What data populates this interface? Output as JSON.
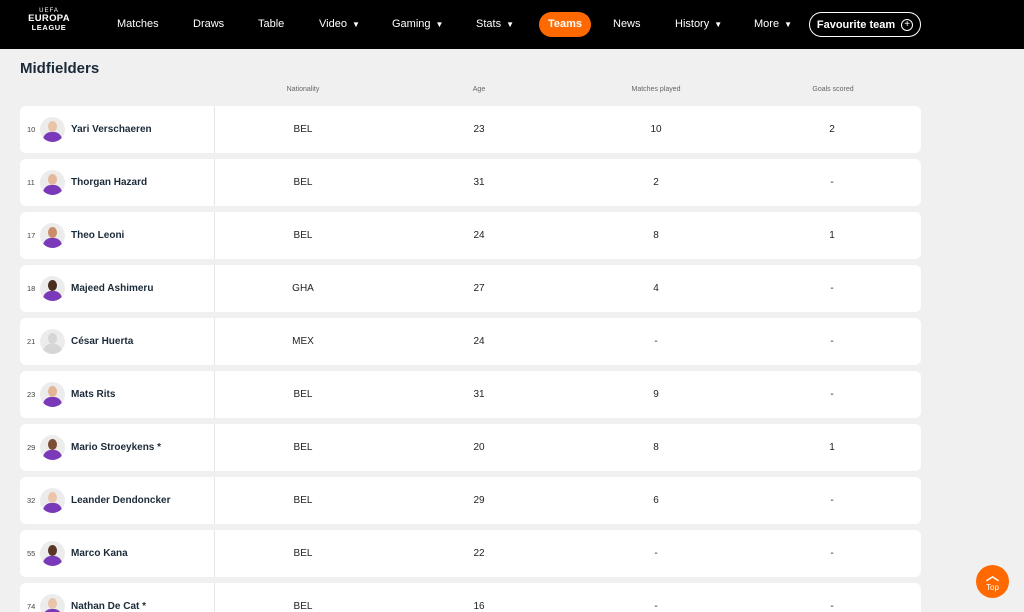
{
  "brand": {
    "line1": "UEFA",
    "line2": "EUROPA",
    "line3": "LEAGUE"
  },
  "nav": {
    "items": [
      {
        "label": "Matches",
        "dropdown": false
      },
      {
        "label": "Draws",
        "dropdown": false
      },
      {
        "label": "Table",
        "dropdown": false
      },
      {
        "label": "Video",
        "dropdown": true
      },
      {
        "label": "Gaming",
        "dropdown": true
      },
      {
        "label": "Stats",
        "dropdown": true
      },
      {
        "label": "Teams",
        "dropdown": false,
        "active": true
      },
      {
        "label": "News",
        "dropdown": false
      },
      {
        "label": "History",
        "dropdown": true
      },
      {
        "label": "More",
        "dropdown": true
      }
    ],
    "caret": "▼",
    "favourite_label": "Favourite team",
    "favourite_icon": "plus-circle-icon"
  },
  "section": {
    "title": "Midfielders"
  },
  "columns": {
    "nationality": "Nationality",
    "age": "Age",
    "matches": "Matches played",
    "goals": "Goals scored"
  },
  "players": [
    {
      "num": "10",
      "name": "Yari Verschaeren",
      "nat": "BEL",
      "age": "23",
      "matches": "10",
      "goals": "2",
      "skin": "#e8c4a8",
      "photo": true
    },
    {
      "num": "11",
      "name": "Thorgan Hazard",
      "nat": "BEL",
      "age": "31",
      "matches": "2",
      "goals": "-",
      "skin": "#e3b99a",
      "photo": true
    },
    {
      "num": "17",
      "name": "Theo Leoni",
      "nat": "BEL",
      "age": "24",
      "matches": "8",
      "goals": "1",
      "skin": "#c98d6a",
      "photo": true
    },
    {
      "num": "18",
      "name": "Majeed Ashimeru",
      "nat": "GHA",
      "age": "27",
      "matches": "4",
      "goals": "-",
      "skin": "#4a2e20",
      "photo": true
    },
    {
      "num": "21",
      "name": "César Huerta",
      "nat": "MEX",
      "age": "24",
      "matches": "-",
      "goals": "-",
      "skin": "#d6d6d6",
      "photo": false
    },
    {
      "num": "23",
      "name": "Mats Rits",
      "nat": "BEL",
      "age": "31",
      "matches": "9",
      "goals": "-",
      "skin": "#e2b596",
      "photo": true
    },
    {
      "num": "29",
      "name": "Mario Stroeykens *",
      "nat": "BEL",
      "age": "20",
      "matches": "8",
      "goals": "1",
      "skin": "#7b4e36",
      "photo": true
    },
    {
      "num": "32",
      "name": "Leander Dendoncker",
      "nat": "BEL",
      "age": "29",
      "matches": "6",
      "goals": "-",
      "skin": "#ebc6ab",
      "photo": true
    },
    {
      "num": "55",
      "name": "Marco Kana",
      "nat": "BEL",
      "age": "22",
      "matches": "-",
      "goals": "-",
      "skin": "#5a3626",
      "photo": true
    },
    {
      "num": "74",
      "name": "Nathan De Cat *",
      "nat": "BEL",
      "age": "16",
      "matches": "-",
      "goals": "-",
      "skin": "#eac5aa",
      "photo": true
    }
  ],
  "scroll_top": {
    "label": "Top",
    "icon": "chevron-up-icon"
  },
  "colors": {
    "accent": "#ff6900",
    "nav_bg": "#000000",
    "page_bg": "#f0f0f0",
    "kit": "#7a39b8"
  }
}
